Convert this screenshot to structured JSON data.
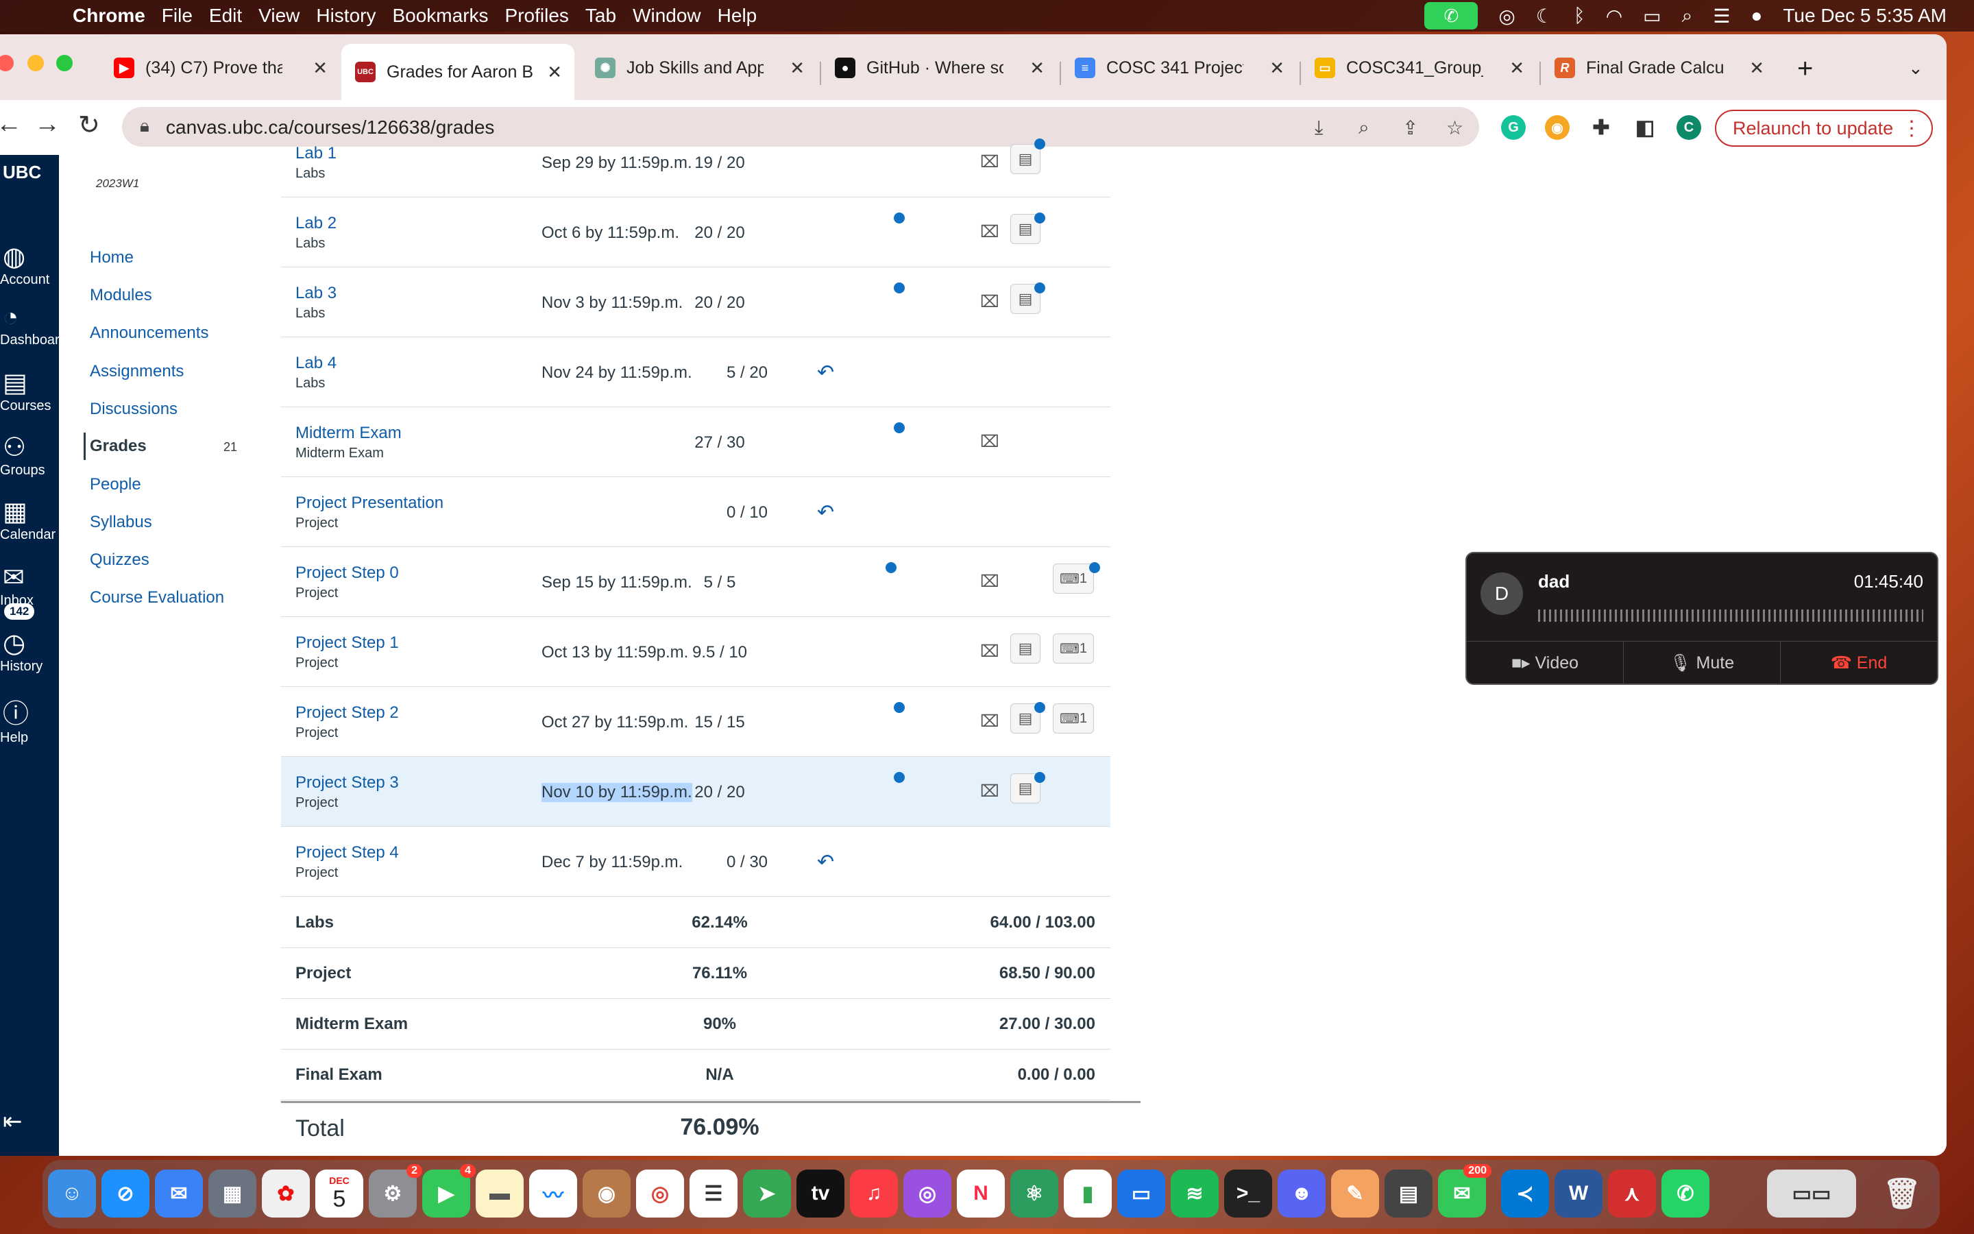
{
  "menubar": {
    "app": "Chrome",
    "items": [
      "File",
      "Edit",
      "View",
      "History",
      "Bookmarks",
      "Profiles",
      "Tab",
      "Window",
      "Help"
    ],
    "clock": "Tue Dec 5  5:35 AM"
  },
  "tabs": [
    {
      "title": "(34) C7) Prove tha",
      "icon": "youtube-icon",
      "color": "#ff0000"
    },
    {
      "title": "Grades for Aaron B",
      "icon": "ubc-canvas-icon",
      "color": "#b01e23",
      "active": true
    },
    {
      "title": "Job Skills and Appl",
      "icon": "chatgpt-icon",
      "color": "#74aa9c"
    },
    {
      "title": "GitHub · Where sof",
      "icon": "github-icon",
      "color": "#111111"
    },
    {
      "title": "COSC 341 Project",
      "icon": "google-docs-icon",
      "color": "#4285f4"
    },
    {
      "title": "COSC341_Group_",
      "icon": "google-slides-icon",
      "color": "#f4b400"
    },
    {
      "title": "Final Grade Calcula",
      "icon": "rapidtables-icon",
      "color": "#e0622a"
    }
  ],
  "toolbar": {
    "url": "canvas.ubc.ca/courses/126638/grades",
    "relaunch_label": "Relaunch to update",
    "profile_initial": "C"
  },
  "global_nav": [
    {
      "label": "UBC",
      "icon": "ubc-logo-icon"
    },
    {
      "label": "Account",
      "icon": "account-icon"
    },
    {
      "label": "Dashboard",
      "icon": "dashboard-icon"
    },
    {
      "label": "Courses",
      "icon": "courses-icon"
    },
    {
      "label": "Groups",
      "icon": "groups-icon"
    },
    {
      "label": "Calendar",
      "icon": "calendar-icon"
    },
    {
      "label": "Inbox",
      "icon": "inbox-icon",
      "badge": "142"
    },
    {
      "label": "History",
      "icon": "history-icon"
    },
    {
      "label": "Help",
      "icon": "help-icon"
    }
  ],
  "course_nav": {
    "term": "2023W1",
    "items": [
      "Home",
      "Modules",
      "Announcements",
      "Assignments",
      "Discussions",
      "Grades",
      "People",
      "Syllabus",
      "Quizzes",
      "Course Evaluation"
    ],
    "active": "Grades",
    "grades_count": "21"
  },
  "assignments": [
    {
      "name": "Lab 1",
      "category": "Labs",
      "due": "Sep 29 by 11:59p.m.",
      "score": "19 / 20"
    },
    {
      "name": "Lab 2",
      "category": "Labs",
      "due": "Oct 6 by 11:59p.m.",
      "score": "20 / 20"
    },
    {
      "name": "Lab 3",
      "category": "Labs",
      "due": "Nov 3 by 11:59p.m.",
      "score": "20 / 20"
    },
    {
      "name": "Lab 4",
      "category": "Labs",
      "due": "Nov 24 by 11:59p.m.",
      "score": "5 / 20"
    },
    {
      "name": "Midterm Exam",
      "category": "Midterm Exam",
      "due": "",
      "score": "27 / 30"
    },
    {
      "name": "Project Presentation",
      "category": "Project",
      "due": "",
      "score": "0 / 10"
    },
    {
      "name": "Project Step 0",
      "category": "Project",
      "due": "Sep 15 by 11:59p.m.",
      "score": "5 / 5",
      "comments": "1"
    },
    {
      "name": "Project Step 1",
      "category": "Project",
      "due": "Oct 13 by 11:59p.m.",
      "score": "9.5 / 10",
      "comments": "1"
    },
    {
      "name": "Project Step 2",
      "category": "Project",
      "due": "Oct 27 by 11:59p.m.",
      "score": "15 / 15",
      "comments": "1"
    },
    {
      "name": "Project Step 3",
      "category": "Project",
      "due": "Nov 10 by 11:59p.m.",
      "score": "20 / 20"
    },
    {
      "name": "Project Step 4",
      "category": "Project",
      "due": "Dec 7 by 11:59p.m.",
      "score": "0 / 30"
    }
  ],
  "summary": [
    {
      "name": "Labs",
      "percent": "62.14%",
      "points": "64.00 / 103.00"
    },
    {
      "name": "Project",
      "percent": "76.11%",
      "points": "68.50 / 90.00"
    },
    {
      "name": "Midterm Exam",
      "percent": "90%",
      "points": "27.00 / 30.00"
    },
    {
      "name": "Final Exam",
      "percent": "N/A",
      "points": "0.00 / 0.00"
    }
  ],
  "total": {
    "label": "Total",
    "value": "76.09%"
  },
  "call": {
    "initial": "D",
    "name": "dad",
    "duration": "01:45:40",
    "video_label": "Video",
    "mute_label": "Mute",
    "end_label": "End"
  },
  "dock": {
    "calendar_month": "DEC",
    "calendar_day": "5",
    "badges": {
      "settings": "2",
      "facetime": "4",
      "messages": "200"
    }
  },
  "colors": {
    "canvas_nav": "#002145",
    "link": "#0f5ca8",
    "selected_row": "#e5f1fb",
    "dot": "#0f70c4",
    "relaunch": "#c4302b"
  }
}
